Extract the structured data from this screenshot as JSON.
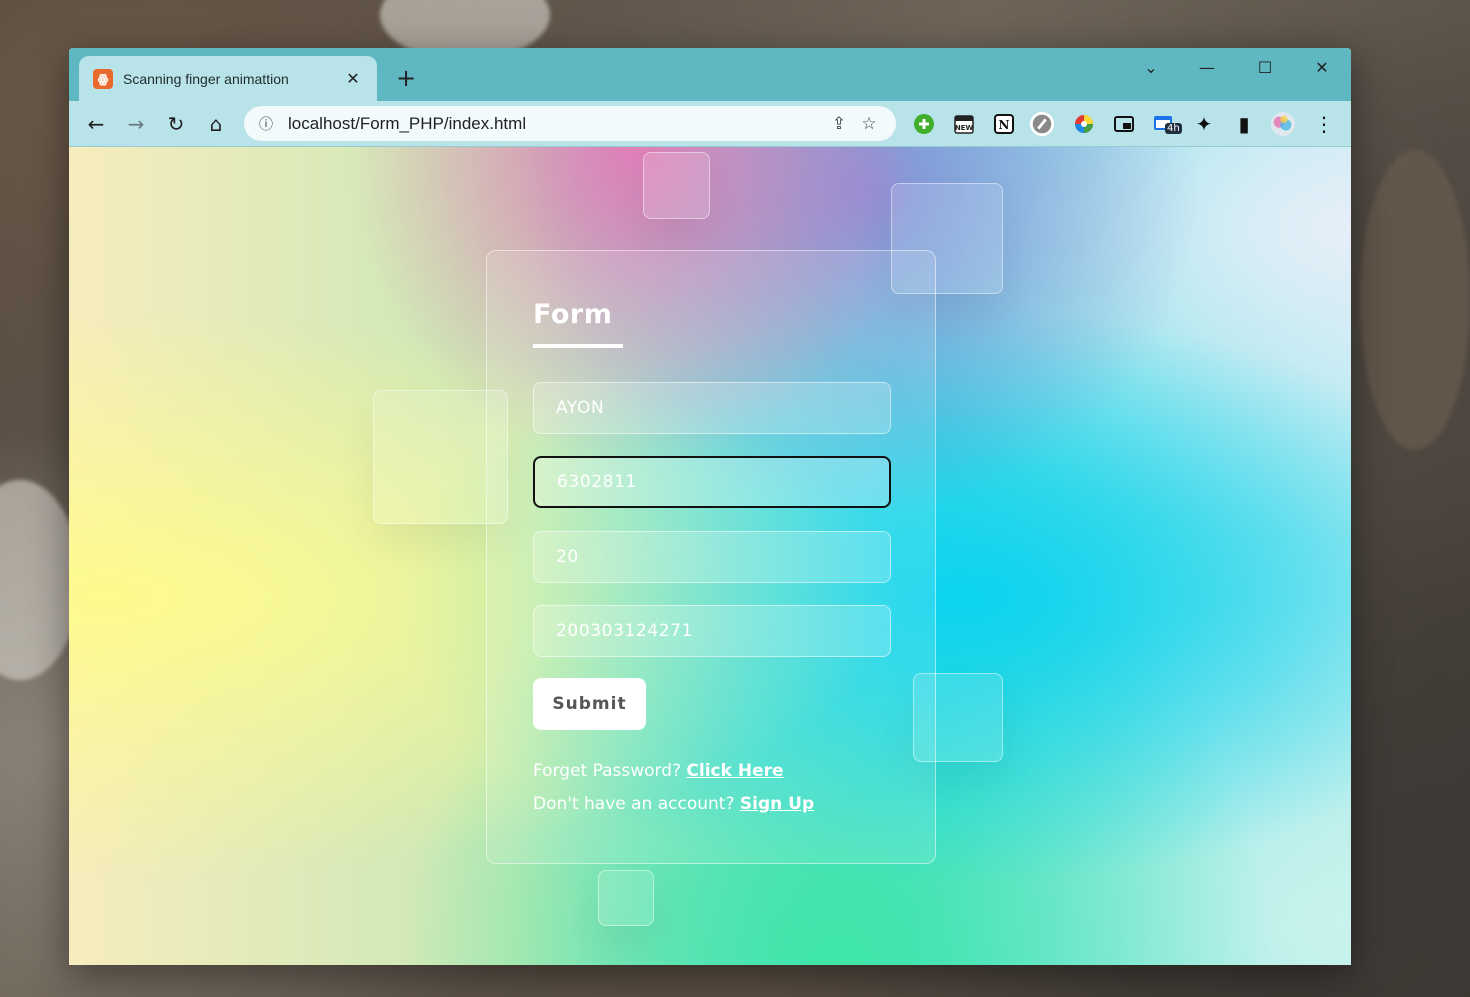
{
  "browser": {
    "tab_title": "Scanning finger animattion",
    "favicon_label": "ꙮ",
    "url": "localhost/Form_PHP/index.html",
    "extension_badge": "4h",
    "icons": {
      "back": "←",
      "forward": "→",
      "reload": "↻",
      "home": "⌂",
      "info": "ⓘ",
      "share": "⇪",
      "star": "☆",
      "close": "✕",
      "new_tab": "+",
      "minimize": "—",
      "maximize": "☐",
      "dropdown": "⌄",
      "more": "⋮",
      "puzzle": "✦",
      "sidepanel": "▮"
    }
  },
  "form": {
    "title": "Form",
    "fields": [
      {
        "value": "AYON"
      },
      {
        "value": "6302811"
      },
      {
        "value": "20"
      },
      {
        "value": "200303124271"
      }
    ],
    "submit_label": "Submit",
    "forgot_text": "Forget Password?",
    "forgot_link": "Click Here",
    "signup_text": "Don't have an account?",
    "signup_link": "Sign Up"
  },
  "colors": {
    "titlebar": "#5fb8c1",
    "toolbar": "#b8e3e8",
    "accent_pink": "#e07fb8",
    "accent_yellow": "#fdfb8d",
    "accent_cyan": "#0cd3ef",
    "accent_green": "#3fe6a6"
  }
}
